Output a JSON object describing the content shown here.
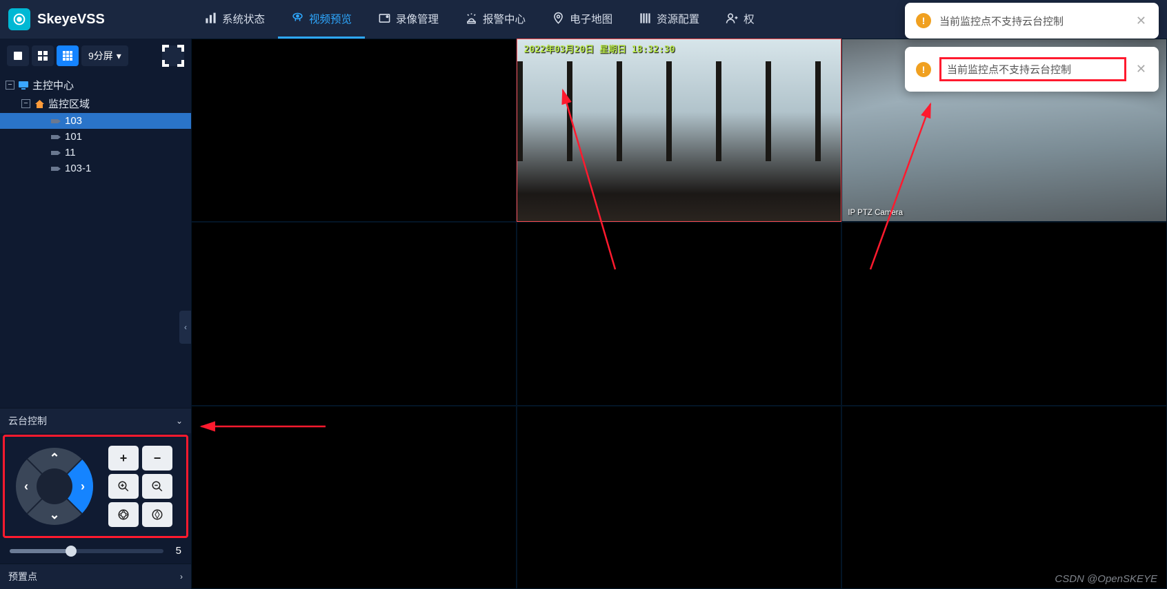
{
  "app": {
    "name": "SkeyeVSS"
  },
  "nav": {
    "items": [
      {
        "label": "系统状态"
      },
      {
        "label": "视频预览"
      },
      {
        "label": "录像管理"
      },
      {
        "label": "报警中心"
      },
      {
        "label": "电子地图"
      },
      {
        "label": "资源配置"
      },
      {
        "label": "权"
      }
    ],
    "active_index": 1
  },
  "layout_selector": {
    "label": "9分屏"
  },
  "tree": {
    "root": "主控中心",
    "group": "监控区域",
    "items": [
      "103",
      "101",
      "11",
      "103-1"
    ],
    "selected_index": 0
  },
  "ptz": {
    "title": "云台控制",
    "speed": 5
  },
  "preset": {
    "title": "预置点"
  },
  "feed1": {
    "timestamp": "2022年03月20日 星期日 18:32:30"
  },
  "feed2": {
    "label": "IP PTZ Camera"
  },
  "toast": {
    "message1": "当前监控点不支持云台控制",
    "message2": "当前监控点不支持云台控制"
  },
  "watermark": "CSDN @OpenSKEYE"
}
